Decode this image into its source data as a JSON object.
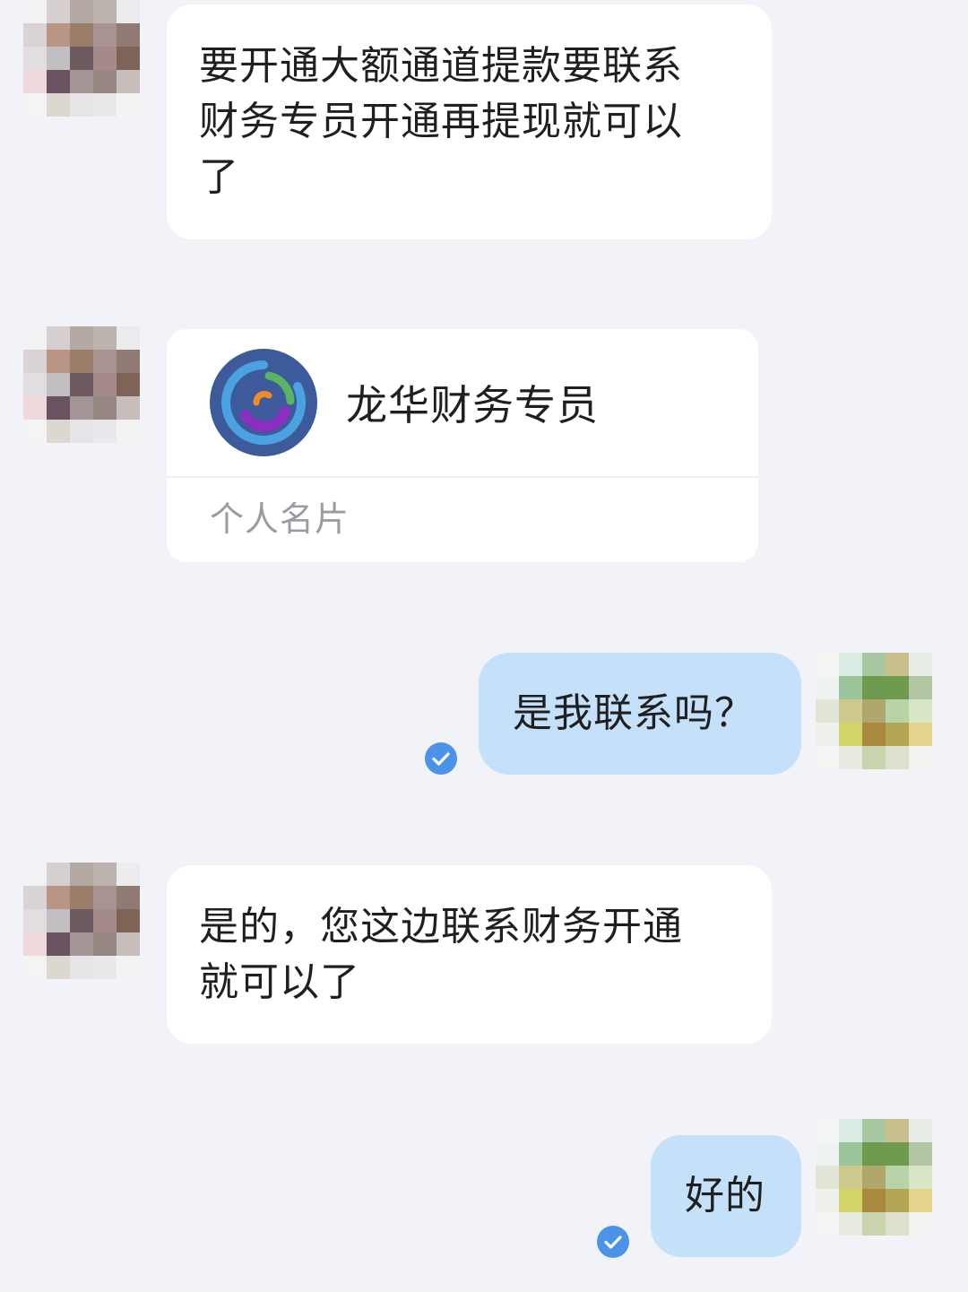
{
  "conversation": {
    "messages": [
      {
        "direction": "incoming",
        "kind": "text",
        "lines": [
          "要开通大额通道提款要联系",
          "财务专员开通再提现就可以",
          "了"
        ]
      },
      {
        "direction": "incoming",
        "kind": "contact_card",
        "card": {
          "name": "龙华财务专员",
          "label": "个人名片",
          "logo_icon": "circular-blue-green-purple-logo"
        }
      },
      {
        "direction": "outgoing",
        "kind": "text",
        "text": "是我联系吗？",
        "status_icon": "read-check-icon"
      },
      {
        "direction": "incoming",
        "kind": "text",
        "lines": [
          "是的，您这边联系财务开通",
          "就可以了"
        ]
      },
      {
        "direction": "outgoing",
        "kind": "text",
        "text": "好的",
        "status_icon": "read-check-icon"
      }
    ]
  },
  "colors": {
    "background": "#f2f3f8",
    "incoming_bubble": "#ffffff",
    "outgoing_bubble": "#c4e1f9",
    "read_check": "#4b93e8",
    "card_label": "#9a9ca2"
  },
  "avatars": {
    "contact": "pixelated-avatar-brown",
    "self": "pixelated-avatar-green"
  }
}
